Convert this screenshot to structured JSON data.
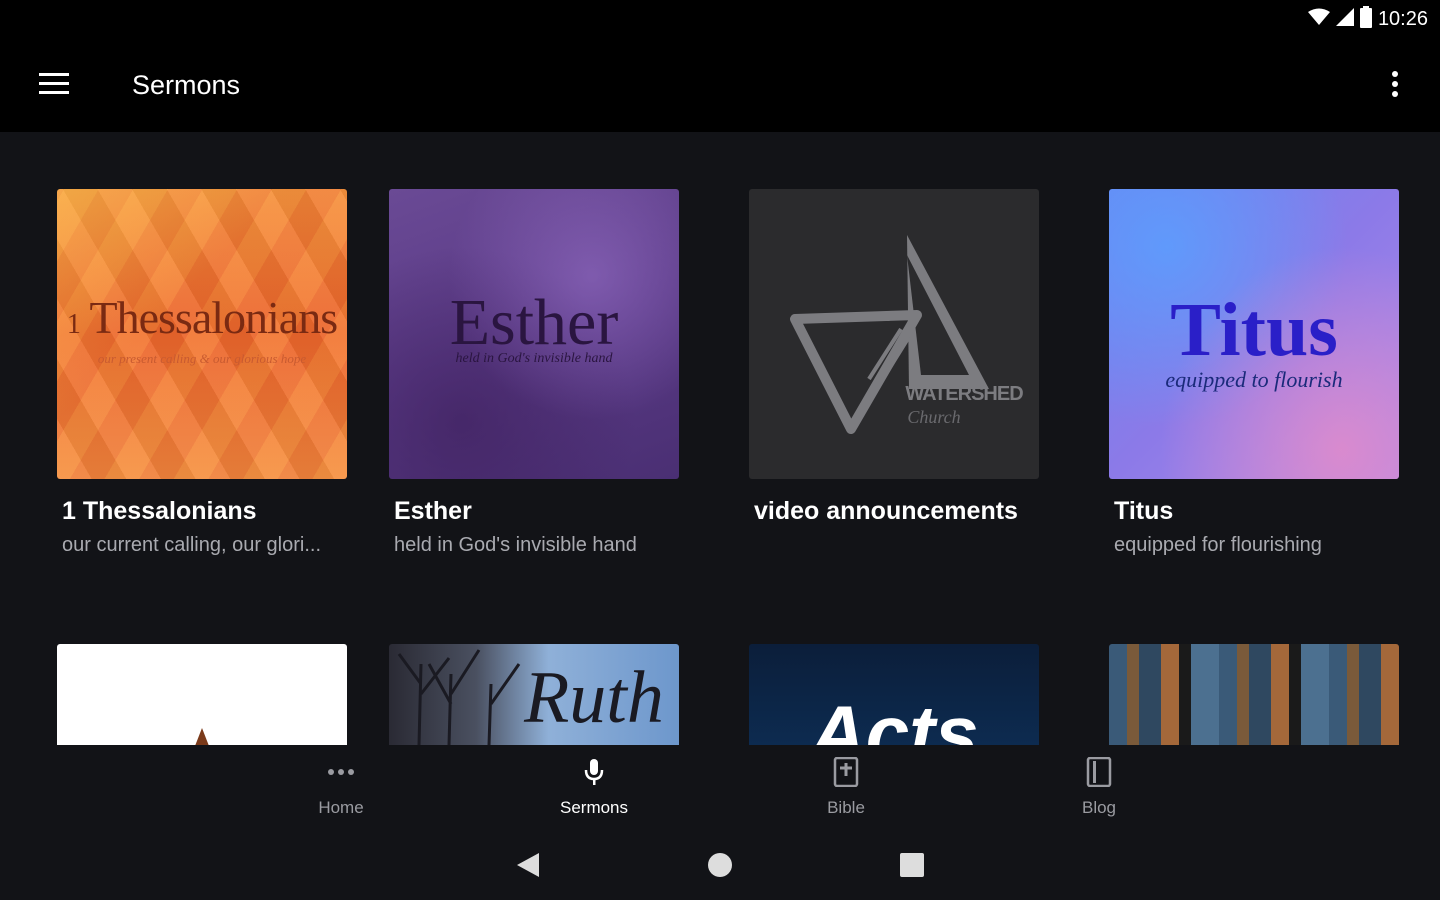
{
  "status": {
    "time": "10:26"
  },
  "app_bar": {
    "title": "Sermons"
  },
  "cards": [
    {
      "title": "1 Thessalonians",
      "subtitle": "our current calling, our glori...",
      "art_word": "Thessalonians",
      "art_prefix": "1",
      "art_tagline": "our present calling & our glorious hope"
    },
    {
      "title": "Esther",
      "subtitle": "held in God's invisible hand",
      "art_word": "Esther",
      "art_tagline": "held in God's invisible hand"
    },
    {
      "title": "video announcements",
      "subtitle": "",
      "art_word": "WATERSHED",
      "art_tagline": "Church"
    },
    {
      "title": "Titus",
      "subtitle": "equipped for flourishing",
      "art_word": "Titus",
      "art_tagline": "equipped to flourish"
    }
  ],
  "row2": [
    {
      "art_word": ""
    },
    {
      "art_word": "Ruth"
    },
    {
      "art_word": "Acts"
    },
    {
      "art_word": ""
    }
  ],
  "bottom_nav": [
    {
      "label": "Home",
      "icon": "more-horiz-icon",
      "active": false
    },
    {
      "label": "Sermons",
      "icon": "mic-icon",
      "active": true
    },
    {
      "label": "Bible",
      "icon": "bible-icon",
      "active": false
    },
    {
      "label": "Blog",
      "icon": "book-icon",
      "active": false
    }
  ],
  "colors": {
    "background": "#121317",
    "bar": "#000000",
    "subtitle": "#a9aab0"
  }
}
